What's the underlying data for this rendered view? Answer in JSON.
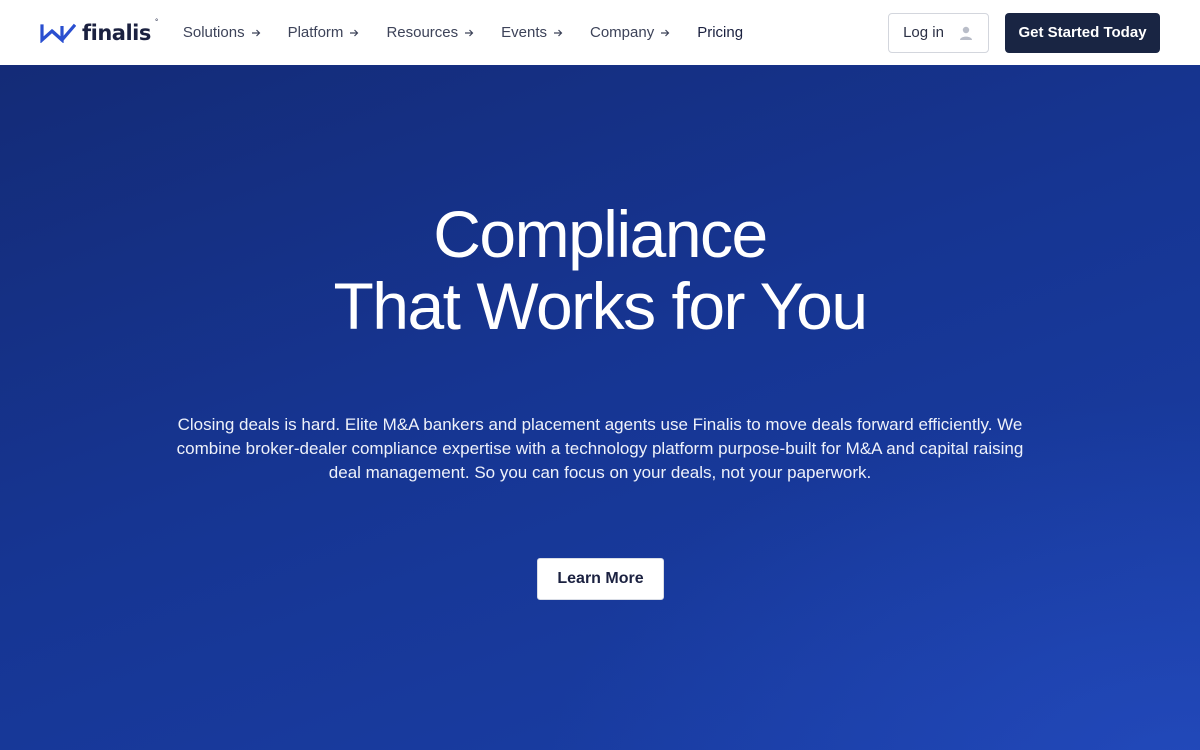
{
  "header": {
    "logo": {
      "text": "finalis",
      "tm": "°"
    },
    "nav": [
      {
        "label": "Solutions",
        "has_arrow": true
      },
      {
        "label": "Platform",
        "has_arrow": true
      },
      {
        "label": "Resources",
        "has_arrow": true
      },
      {
        "label": "Events",
        "has_arrow": true
      },
      {
        "label": "Company",
        "has_arrow": true
      },
      {
        "label": "Pricing",
        "has_arrow": false
      }
    ],
    "login_label": "Log in",
    "cta_label": "Get Started Today"
  },
  "hero": {
    "title_line1": "Compliance",
    "title_line2": "That Works for You",
    "description": "Closing deals is hard. Elite M&A bankers and placement agents use Finalis to move deals forward efficiently. We combine broker-dealer compliance expertise with a technology platform purpose-built for M&A and capital raising deal management. So you can focus on your deals, not your paperwork.",
    "button_label": "Learn More"
  },
  "colors": {
    "brand_navy": "#192543",
    "logo_blue": "#2a4fd0",
    "hero_blue": "#163592"
  },
  "icons": {
    "logo_mark": "finalis-logo-icon",
    "nav_arrow": "arrow-right-icon",
    "login": "user-icon"
  }
}
